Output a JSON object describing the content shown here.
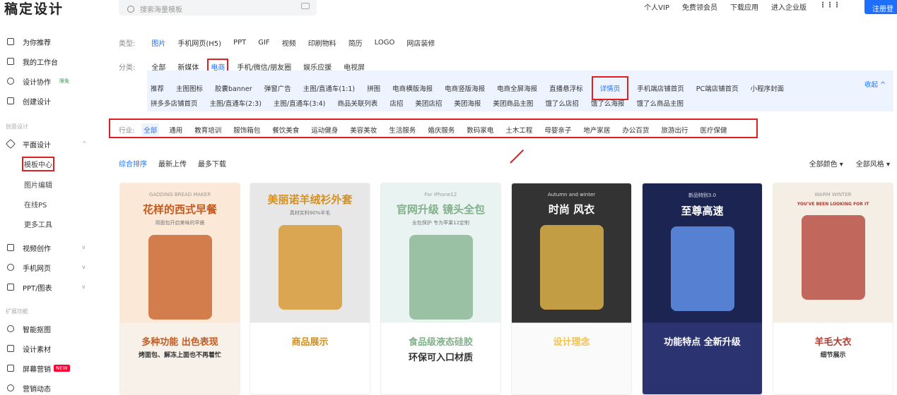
{
  "app": {
    "logo": "稿定设计",
    "search_placeholder": "搜索海量模板",
    "links": [
      "个人VIP",
      "免费领会员",
      "下载应用",
      "进入企业版"
    ],
    "register": "注册登录"
  },
  "sidebar": {
    "main": [
      "为你推荐",
      "我的工作台",
      "设计协作",
      "创建设计"
    ],
    "collab_badge": "限免",
    "section1": "创意设计",
    "design": "平面设计",
    "sub": [
      "模板中心",
      "图片编辑",
      "在线PS",
      "更多工具"
    ],
    "others": [
      "视频创作",
      "手机网页",
      "PPT/图表"
    ],
    "section2": "扩展功能",
    "ext": [
      "智能抠图",
      "设计素材",
      "屏幕营销",
      "营销动态"
    ],
    "new_badge": "NEW"
  },
  "filters": {
    "type_label": "类型:",
    "types": [
      "图片",
      "手机网页(H5)",
      "PPT",
      "GIF",
      "视频",
      "印刷物料",
      "简历",
      "LOGO",
      "网店装修"
    ],
    "cat_label": "分类:",
    "cats": [
      "全部",
      "新媒体",
      "电商",
      "手机/微信/朋友圈",
      "娱乐应援",
      "电视屏"
    ],
    "sub1": [
      "推荐",
      "主图图标",
      "胶囊banner",
      "弹窗广告",
      "主图/直通车(1:1)",
      "拼图",
      "电商横版海报",
      "电商竖版海报",
      "电商全屏海报",
      "直播悬浮标",
      "详情页",
      "手机端店铺首页",
      "PC端店铺首页",
      "小程序封面"
    ],
    "collapse": "收起 ^",
    "sub2": [
      "拼多多店铺首页",
      "主图/直通车(2:3)",
      "主图/直通车(3:4)",
      "商品关联列表",
      "店招",
      "美团店招",
      "美团海报",
      "美团商品主图",
      "饿了么店招",
      "饿了么海报",
      "饿了么商品主图"
    ],
    "ind_label": "行业:",
    "inds": [
      "全部",
      "通用",
      "教育培训",
      "服饰箱包",
      "餐饮美食",
      "运动健身",
      "美容美妆",
      "生活服务",
      "婚庆服务",
      "数码家电",
      "土木工程",
      "母婴亲子",
      "地产家居",
      "办公百货",
      "旅游出行",
      "医疗保健"
    ]
  },
  "sort": [
    "综合排序",
    "最新上传",
    "最多下载"
  ],
  "color_filter": "全部颜色 ▾",
  "style_filter": "全部风格 ▾",
  "cards": [
    {
      "top": "GAODING BREAD MAKER",
      "title": "花样的西式早餐",
      "sub": "用面包开启美味的早晨",
      "bottom": "多种功能 出色表现",
      "bottom2": "烤面包、解冻上面也不再着忙",
      "c1": "#fbe8d6",
      "c2": "#f7f1ea",
      "accent": "#c65a1e"
    },
    {
      "top": "",
      "title": "美丽诺羊绒衫外套",
      "sub": "真材实料90%羊毛",
      "bottom": "商品展示",
      "bottom2": "",
      "c1": "#e7e7e7",
      "c2": "#ffffff",
      "accent": "#d6901f"
    },
    {
      "top": "For iPhone12",
      "title": "官网升级 镜头全包",
      "sub": "全包保护 专为苹果12定制",
      "bottom": "食品级液态硅胶",
      "bottom2": "环保可入口材质",
      "c1": "#e8f3f2",
      "c2": "#ffffff",
      "accent": "#82b08a"
    },
    {
      "top": "Autumn and winter",
      "title": "时尚 风衣",
      "sub": "",
      "bottom": "设计理念",
      "bottom2": "",
      "c1": "#333",
      "c2": "#fafafa",
      "accent": "#f4c24a"
    },
    {
      "top": "新品特别3.0",
      "title": "至尊高速",
      "sub": "",
      "bottom": "功能特点 全新升级",
      "bottom2": "",
      "c1": "#1c2451",
      "c2": "#2b3470",
      "accent": "#6aa0ff"
    },
    {
      "top": "WARM WINTER",
      "title": "YOU'VE BEEN LOOKING FOR IT",
      "sub": "",
      "bottom": "羊毛大衣",
      "bottom2": "细节展示",
      "c1": "#f5eee4",
      "c2": "#ffffff",
      "accent": "#b03a2e"
    }
  ]
}
